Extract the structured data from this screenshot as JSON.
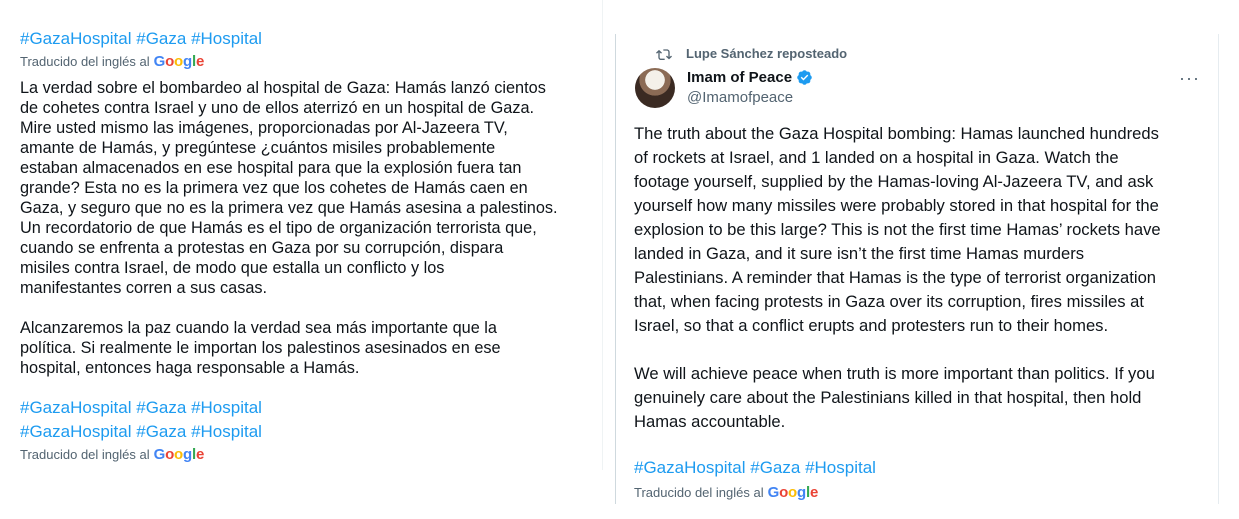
{
  "left": {
    "hashtags_top": [
      "#GazaHospital",
      "#Gaza",
      "#Hospital"
    ],
    "translated_label": "Traducido del inglés al",
    "google_logo": "Google",
    "paragraph1": "La verdad sobre el bombardeo al hospital de Gaza: Hamás lanzó cientos\nde cohetes contra Israel y uno de ellos aterrizó en un hospital de Gaza.\nMire usted mismo las imágenes, proporcionadas por Al-Jazeera TV,\namante de Hamás, y pregúntese ¿cuántos misiles probablemente\nestaban almacenados en ese hospital para que la explosión fuera tan\ngrande? Esta no es la primera vez que los cohetes de Hamás caen en\nGaza, y seguro que no es la primera vez que Hamás asesina a palestinos.\nUn recordatorio de que Hamás es el tipo de organización terrorista que,\ncuando se enfrenta a protestas en Gaza por su corrupción, dispara\nmisiles contra Israel, de modo que estalla un conflicto y los\nmanifestantes corren a sus casas.",
    "paragraph2": "Alcanzaremos la paz cuando la verdad sea más importante que la\npolítica. Si realmente le importan los palestinos asesinados en ese\nhospital, entonces haga responsable a Hamás.",
    "hashtags_bottom1": [
      "#GazaHospital",
      "#Gaza",
      "#Hospital"
    ],
    "hashtags_bottom2": [
      "#GazaHospital",
      "#Gaza",
      "#Hospital"
    ]
  },
  "right": {
    "repost_label": "Lupe Sánchez reposteado",
    "author_name": "Imam of Peace",
    "author_handle": "@Imamofpeace",
    "more_label": "···",
    "paragraph1": "The truth about the Gaza Hospital bombing: Hamas launched hundreds\nof rockets at Israel, and 1 landed on a hospital in Gaza. Watch the\nfootage yourself, supplied by the Hamas-loving Al-Jazeera TV, and ask\nyourself how many missiles were probably stored in that hospital for the\nexplosion to be this large? This is not the first time Hamas’ rockets have\nlanded in Gaza, and it sure isn’t the first time Hamas murders\nPalestinians. A reminder that Hamas is the type of terrorist organization\nthat, when facing protests in Gaza over its corruption, fires missiles at\nIsrael, so that a conflict erupts and protesters run to their homes.",
    "paragraph2": "We will achieve peace when truth is more important than politics. If you\ngenuinely care about the Palestinians killed in that hospital, then hold\nHamas accountable.",
    "hashtags": [
      "#GazaHospital",
      "#Gaza",
      "#Hospital"
    ],
    "translated_label": "Traducido del inglés al",
    "google_logo": "Google"
  },
  "colors": {
    "link": "#1d9bf0",
    "secondary_text": "#536471",
    "verified": "#1d9bf0"
  },
  "icons": [
    "repost-icon",
    "verified-badge-icon",
    "more-options-icon",
    "google-logo"
  ]
}
